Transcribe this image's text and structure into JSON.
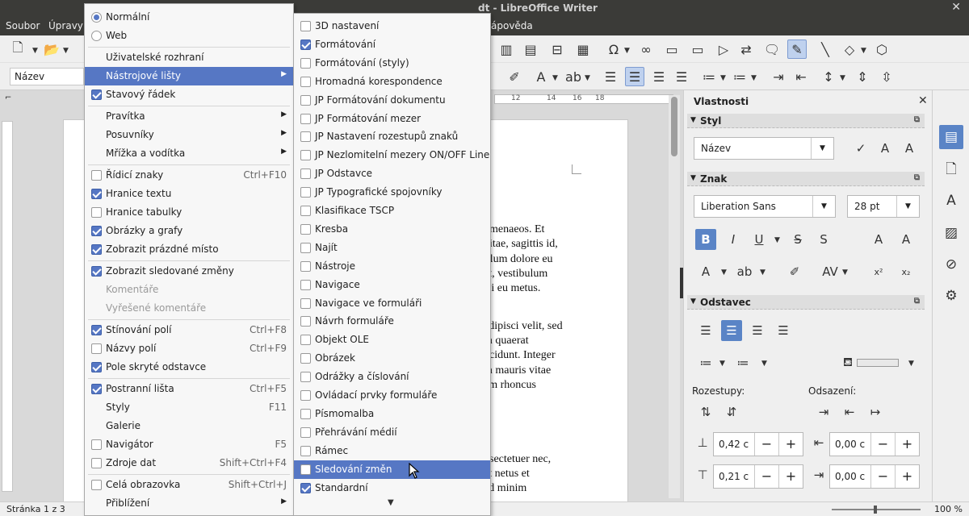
{
  "window": {
    "title": "dt - LibreOffice Writer",
    "close": "✕"
  },
  "menubar": {
    "items": [
      "Soubor",
      "Úpravy",
      "ápověda"
    ]
  },
  "toolbar": {
    "paragraph_style": "Název"
  },
  "ruler": {
    "marks": [
      "12",
      "14",
      "16",
      "18"
    ]
  },
  "document": {
    "lines": [
      "ymenaeos. Et",
      "vitae, sagittis id,",
      "illum dolore eu",
      "at, vestibulum",
      "isi eu metus.",
      "adipisci velit, sed",
      "m quaerat",
      "ncidunt. Integer",
      "m mauris vitae",
      "am rhoncus",
      "nsectetuer nec,",
      "et netus et",
      "ad minim"
    ]
  },
  "view_menu": {
    "items": [
      {
        "type": "radio",
        "label": "Normální",
        "checked": true
      },
      {
        "type": "radio",
        "label": "Web",
        "checked": false
      },
      {
        "type": "sep"
      },
      {
        "type": "plain",
        "label": "Uživatelské rozhraní"
      },
      {
        "type": "submenu",
        "label": "Nástrojové lišty",
        "highlighted": true
      },
      {
        "type": "check",
        "label": "Stavový řádek",
        "checked": true
      },
      {
        "type": "sep"
      },
      {
        "type": "submenu",
        "label": "Pravítka"
      },
      {
        "type": "submenu",
        "label": "Posuvníky"
      },
      {
        "type": "submenu",
        "label": "Mřížka a vodítka"
      },
      {
        "type": "sep"
      },
      {
        "type": "check",
        "label": "Řídicí znaky",
        "checked": false,
        "shortcut": "Ctrl+F10"
      },
      {
        "type": "check",
        "label": "Hranice textu",
        "checked": true
      },
      {
        "type": "check",
        "label": "Hranice tabulky",
        "checked": false
      },
      {
        "type": "check",
        "label": "Obrázky a grafy",
        "checked": true
      },
      {
        "type": "check",
        "label": "Zobrazit prázdné místo",
        "checked": true
      },
      {
        "type": "sep"
      },
      {
        "type": "check",
        "label": "Zobrazit sledované změny",
        "checked": true
      },
      {
        "type": "plain",
        "label": "Komentáře",
        "disabled": true
      },
      {
        "type": "plain",
        "label": "Vyřešené komentáře",
        "disabled": true
      },
      {
        "type": "sep"
      },
      {
        "type": "check",
        "label": "Stínování polí",
        "checked": true,
        "shortcut": "Ctrl+F8"
      },
      {
        "type": "check",
        "label": "Názvy polí",
        "checked": false,
        "shortcut": "Ctrl+F9"
      },
      {
        "type": "check",
        "label": "Pole skryté odstavce",
        "checked": true
      },
      {
        "type": "sep"
      },
      {
        "type": "check",
        "label": "Postranní lišta",
        "checked": true,
        "shortcut": "Ctrl+F5"
      },
      {
        "type": "plain",
        "label": "Styly",
        "shortcut": "F11"
      },
      {
        "type": "plain",
        "label": "Galerie"
      },
      {
        "type": "check",
        "label": "Navigátor",
        "checked": false,
        "shortcut": "F5"
      },
      {
        "type": "check",
        "label": "Zdroje dat",
        "checked": false,
        "shortcut": "Shift+Ctrl+F4"
      },
      {
        "type": "sep"
      },
      {
        "type": "check",
        "label": "Celá obrazovka",
        "checked": false,
        "shortcut": "Shift+Ctrl+J"
      },
      {
        "type": "submenu",
        "label": "Přiblížení"
      }
    ]
  },
  "toolbars_menu": {
    "items": [
      {
        "label": "3D nastavení",
        "checked": false
      },
      {
        "label": "Formátování",
        "checked": true
      },
      {
        "label": "Formátování (styly)",
        "checked": false
      },
      {
        "label": "Hromadná korespondence",
        "checked": false
      },
      {
        "label": "JP Formátování dokumentu",
        "checked": false
      },
      {
        "label": "JP Formátování mezer",
        "checked": false
      },
      {
        "label": "JP Nastavení rozestupů znaků",
        "checked": false
      },
      {
        "label": "JP Nezlomitelní mezery ON/OFF Line",
        "checked": false
      },
      {
        "label": "JP Odstavce",
        "checked": false
      },
      {
        "label": "JP Typografické spojovníky",
        "checked": false
      },
      {
        "label": "Klasifikace TSCP",
        "checked": false
      },
      {
        "label": "Kresba",
        "checked": false
      },
      {
        "label": "Najít",
        "checked": false
      },
      {
        "label": "Nástroje",
        "checked": false
      },
      {
        "label": "Navigace",
        "checked": false
      },
      {
        "label": "Navigace ve formuláři",
        "checked": false
      },
      {
        "label": "Návrh formuláře",
        "checked": false
      },
      {
        "label": "Objekt OLE",
        "checked": false
      },
      {
        "label": "Obrázek",
        "checked": false
      },
      {
        "label": "Odrážky a číslování",
        "checked": false
      },
      {
        "label": "Ovládací prvky formuláře",
        "checked": false
      },
      {
        "label": "Písmomalba",
        "checked": false
      },
      {
        "label": "Přehrávání médií",
        "checked": false
      },
      {
        "label": "Rámec",
        "checked": false
      },
      {
        "label": "Sledování změn",
        "checked": false,
        "highlighted": true
      },
      {
        "label": "Standardní",
        "checked": true
      }
    ],
    "scroll_glyph": "▼"
  },
  "sidebar": {
    "title": "Vlastnosti",
    "sections": {
      "style": "Styl",
      "character": "Znak",
      "paragraph": "Odstavec"
    },
    "style_value": "Název",
    "font_name": "Liberation Sans",
    "font_size": "28 pt",
    "spacing_label": "Rozestupy:",
    "indent_label": "Odsazení:",
    "spacing_above": "0,42 c",
    "spacing_below": "0,21 c",
    "indent_before": "0,00 c",
    "indent_after": "0,00 c"
  },
  "statusbar": {
    "page": "Stránka 1 z 3",
    "zoom": "100 %"
  },
  "colors": {
    "accent": "#5677c4",
    "menubar": "#3b3b38"
  }
}
